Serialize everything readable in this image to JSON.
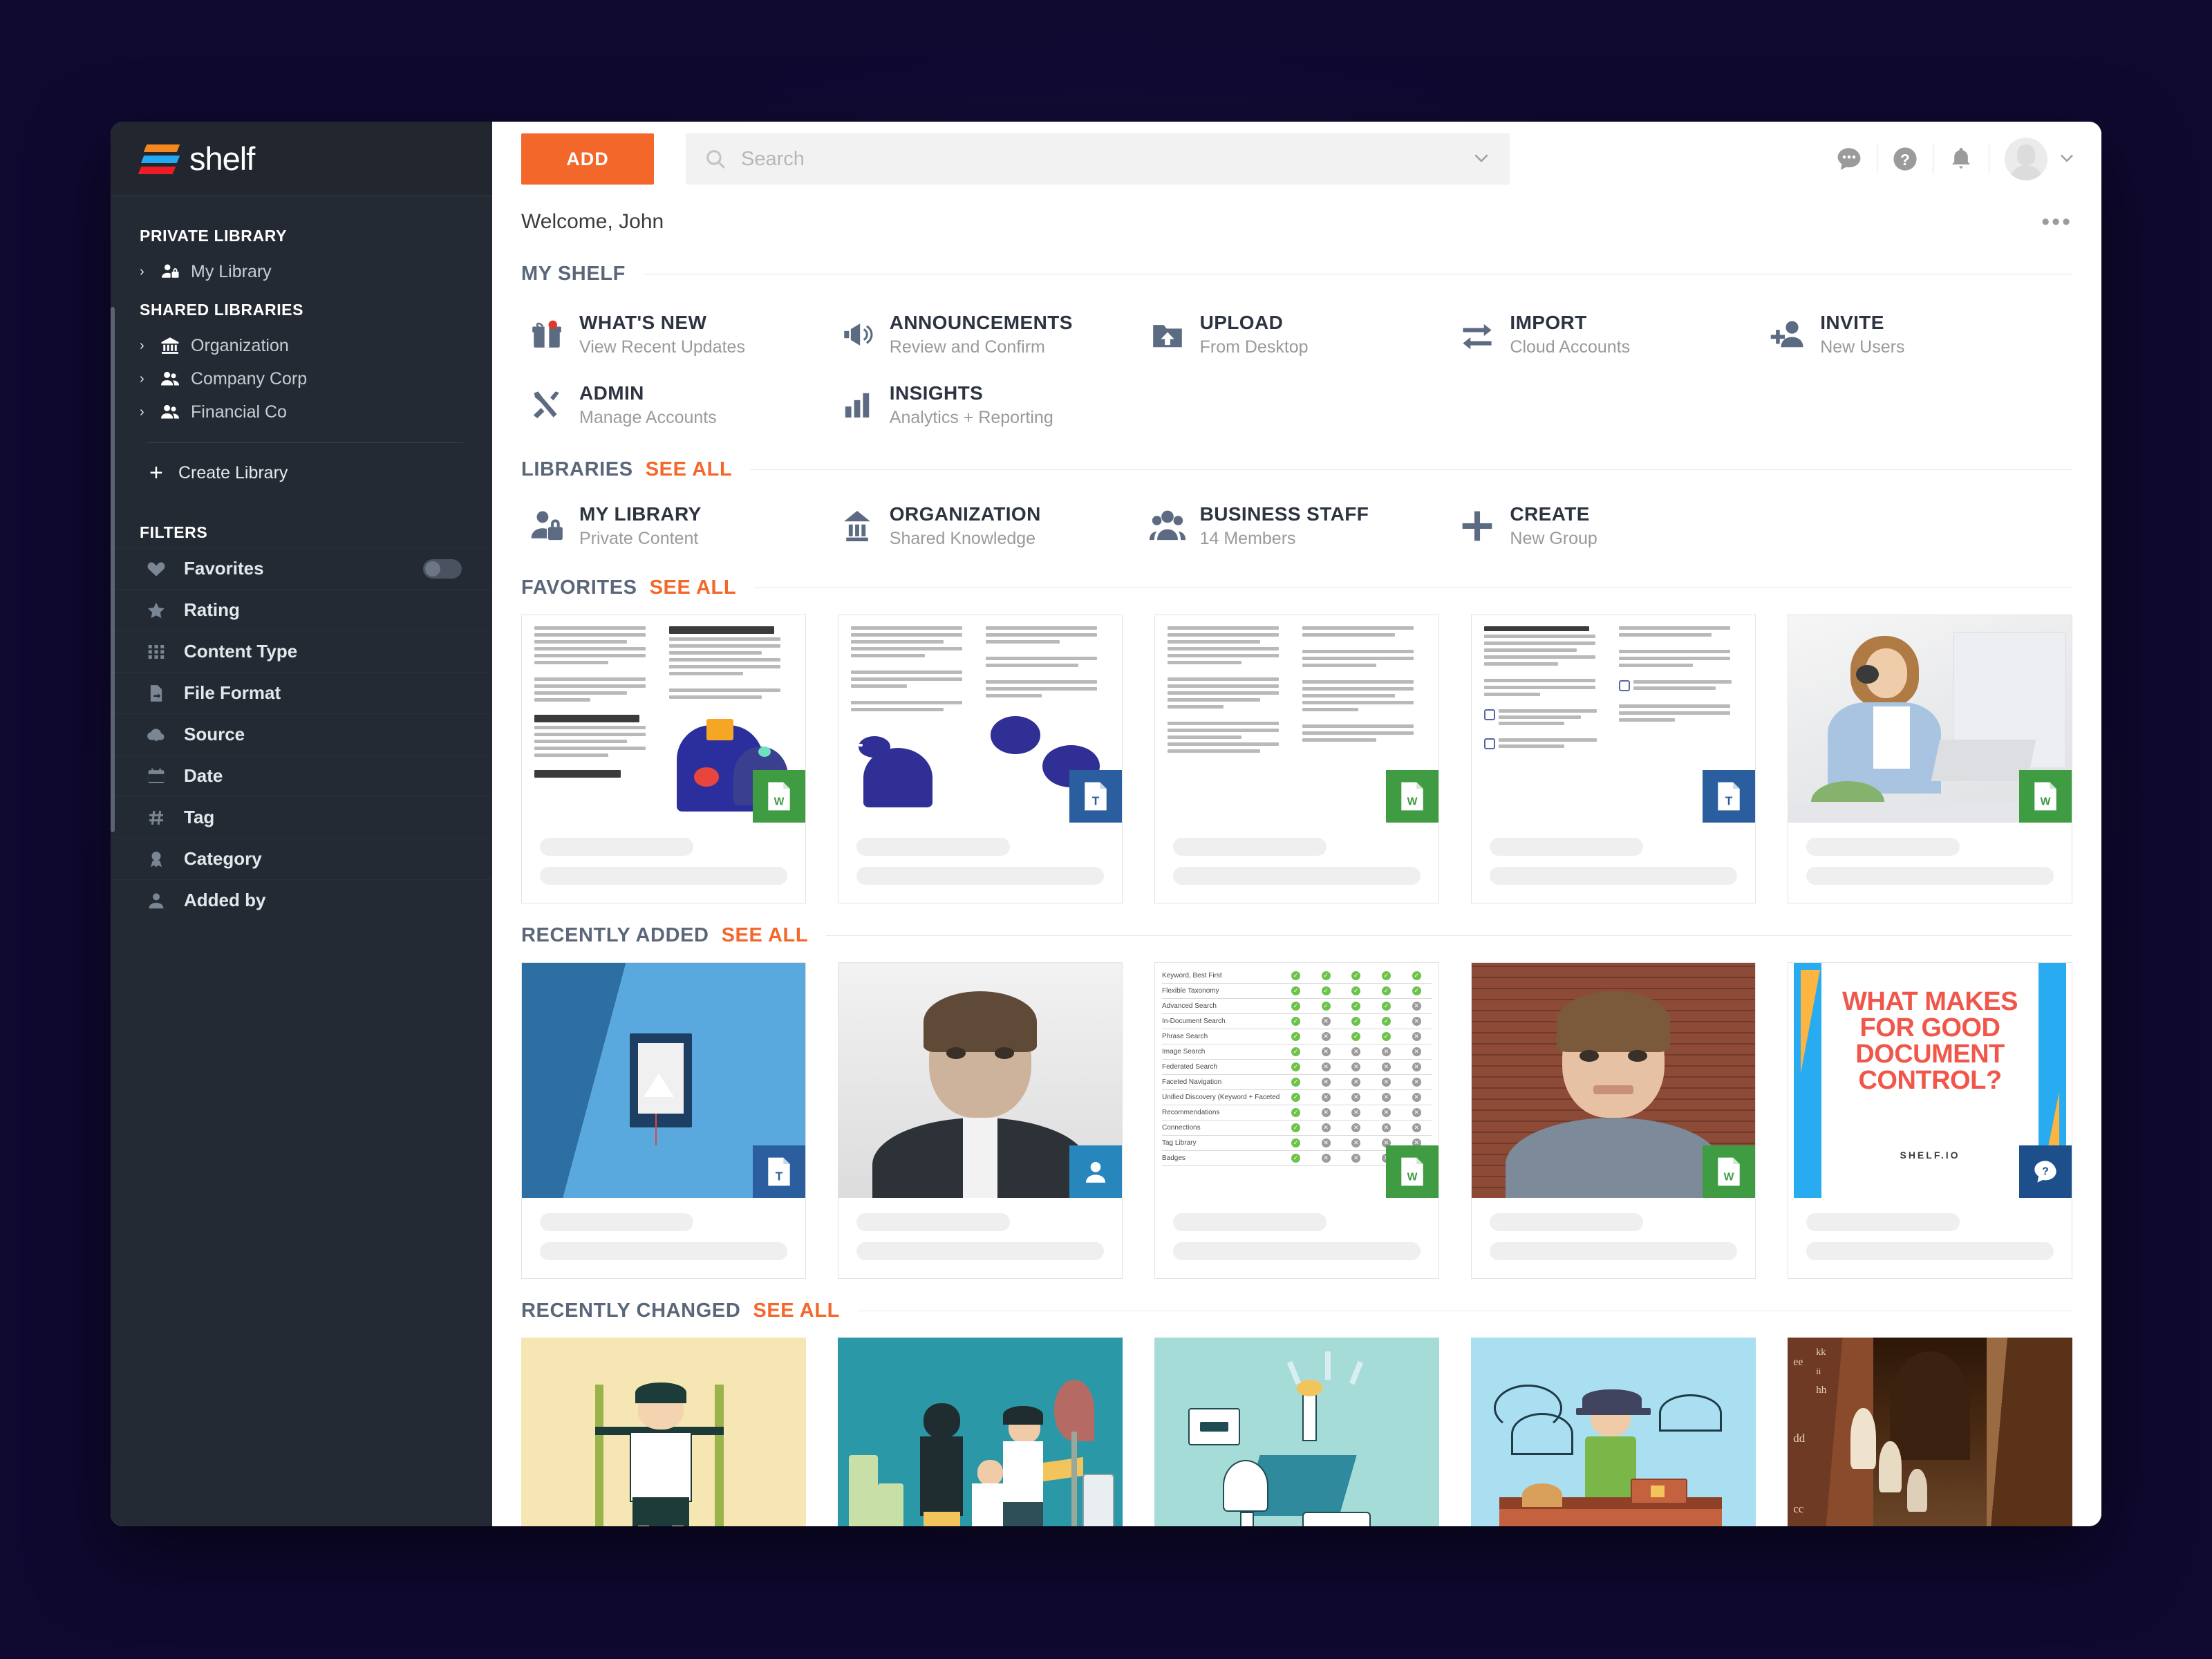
{
  "app": {
    "logo_text": "shelf",
    "logo_colors": [
      "#f5871f",
      "#23a8f2",
      "#ee1c25"
    ],
    "accent": "#f4672b",
    "sidebar_bg": "#242a33"
  },
  "sidebar": {
    "private_header": "PRIVATE LIBRARY",
    "private_items": [
      {
        "label": "My Library",
        "icon": "user-lock-icon",
        "caret": "›"
      }
    ],
    "shared_header": "SHARED LIBRARIES",
    "shared_items": [
      {
        "label": "Organization",
        "icon": "bank-icon",
        "caret": "›"
      },
      {
        "label": "Company Corp",
        "icon": "users-icon",
        "caret": "›"
      },
      {
        "label": "Financial Co",
        "icon": "users-icon",
        "caret": "›"
      }
    ],
    "create_library": "Create Library",
    "create_icon": "plus-icon",
    "filters_header": "FILTERS",
    "filters": [
      {
        "label": "Favorites",
        "icon": "heart-icon",
        "toggle": true,
        "toggle_on": false
      },
      {
        "label": "Rating",
        "icon": "star-icon",
        "toggle": false
      },
      {
        "label": "Content Type",
        "icon": "grid-dots-icon",
        "toggle": false
      },
      {
        "label": "File Format",
        "icon": "file-icon",
        "toggle": false
      },
      {
        "label": "Source",
        "icon": "cloud-download-icon",
        "toggle": false
      },
      {
        "label": "Date",
        "icon": "calendar-icon",
        "toggle": false
      },
      {
        "label": "Tag",
        "icon": "hash-icon",
        "toggle": false
      },
      {
        "label": "Category",
        "icon": "ribbon-icon",
        "toggle": false
      },
      {
        "label": "Added by",
        "icon": "person-icon",
        "toggle": false
      }
    ]
  },
  "topbar": {
    "add_label": "ADD",
    "search_placeholder": "Search",
    "search_value": "",
    "search_icon": "search-icon",
    "dropdown_icon": "chevron-down-icon",
    "icons": [
      {
        "name": "chat-icon"
      },
      {
        "name": "help-icon"
      },
      {
        "name": "bell-icon"
      }
    ],
    "avatar_icon": "avatar",
    "avatar_caret": "chevron-down-icon"
  },
  "welcome": {
    "text": "Welcome, John",
    "overflow_icon": "•••"
  },
  "my_shelf": {
    "title": "MY SHELF",
    "items": [
      {
        "title": "WHAT'S NEW",
        "sub": "View Recent Updates",
        "icon": "gift-icon"
      },
      {
        "title": "ANNOUNCEMENTS",
        "sub": "Review and Confirm",
        "icon": "megaphone-icon"
      },
      {
        "title": "UPLOAD",
        "sub": "From Desktop",
        "icon": "folder-upload-icon"
      },
      {
        "title": "IMPORT",
        "sub": "Cloud Accounts",
        "icon": "transfer-arrows-icon"
      },
      {
        "title": "INVITE",
        "sub": "New Users",
        "icon": "user-plus-icon"
      },
      {
        "title": "ADMIN",
        "sub": "Manage Accounts",
        "icon": "tools-icon"
      },
      {
        "title": "INSIGHTS",
        "sub": "Analytics + Reporting",
        "icon": "bar-chart-icon"
      }
    ]
  },
  "libraries": {
    "title": "LIBRARIES",
    "see_all": "SEE ALL",
    "items": [
      {
        "title": "MY LIBRARY",
        "sub": "Private Content",
        "icon": "user-lock-icon"
      },
      {
        "title": "ORGANIZATION",
        "sub": "Shared Knowledge",
        "icon": "bank-icon"
      },
      {
        "title": "BUSINESS STAFF",
        "sub": "14 Members",
        "icon": "users-icon"
      },
      {
        "title": "CREATE",
        "sub": "New Group",
        "icon": "plus-icon"
      }
    ]
  },
  "favorites": {
    "title": "FAVORITES",
    "see_all": "SEE ALL",
    "cards": [
      {
        "thumb": "document-banking-strategy",
        "badge": "word",
        "badge_label": "W"
      },
      {
        "thumb": "document-chat-bubbles",
        "badge": "text",
        "badge_label": "T"
      },
      {
        "thumb": "document-messaging",
        "badge": "word",
        "badge_label": "W"
      },
      {
        "thumb": "document-banking-chatbot",
        "badge": "text",
        "badge_label": "T"
      },
      {
        "thumb": "photo-headset-agent",
        "badge": "word",
        "badge_label": "W"
      }
    ]
  },
  "recently_added": {
    "title": "RECENTLY ADDED",
    "see_all": "SEE ALL",
    "cards": [
      {
        "thumb": "book-on-blue",
        "badge": "text",
        "badge_label": "T"
      },
      {
        "thumb": "portrait-man-suit",
        "badge": "person",
        "badge_label": ""
      },
      {
        "thumb": "feature-table",
        "badge": "word",
        "badge_label": "W"
      },
      {
        "thumb": "portrait-man-brick",
        "badge": "word",
        "badge_label": "W"
      },
      {
        "thumb": "document-control-poster",
        "badge": "question",
        "badge_label": "?"
      }
    ]
  },
  "recently_changed": {
    "title": "RECENTLY CHANGED",
    "see_all": "SEE ALL",
    "cards": [
      {
        "thumb": "illustration-pullup-cream"
      },
      {
        "thumb": "illustration-family-teal"
      },
      {
        "thumb": "illustration-idea-mint"
      },
      {
        "thumb": "illustration-boat-sky"
      },
      {
        "thumb": "photo-library-hall"
      }
    ]
  },
  "feature_table": {
    "rows": [
      {
        "name": "Keyword, Best First",
        "cells": [
          true,
          true,
          true,
          true,
          true
        ]
      },
      {
        "name": "Flexible Taxonomy",
        "cells": [
          true,
          true,
          true,
          true,
          true
        ]
      },
      {
        "name": "Advanced Search",
        "cells": [
          true,
          true,
          true,
          true,
          false
        ]
      },
      {
        "name": "In-Document Search",
        "cells": [
          true,
          false,
          true,
          true,
          false
        ]
      },
      {
        "name": "Phrase Search",
        "cells": [
          true,
          false,
          true,
          true,
          false
        ]
      },
      {
        "name": "Image Search",
        "cells": [
          true,
          false,
          false,
          false,
          false
        ]
      },
      {
        "name": "Federated Search",
        "cells": [
          true,
          false,
          false,
          false,
          false
        ]
      },
      {
        "name": "Faceted Navigation",
        "cells": [
          true,
          false,
          false,
          false,
          false
        ]
      },
      {
        "name": "Unified Discovery (Keyword + Faceted Search)",
        "cells": [
          true,
          false,
          false,
          false,
          false
        ]
      },
      {
        "name": "Recommendations",
        "cells": [
          true,
          false,
          false,
          false,
          false
        ]
      },
      {
        "name": "Connections",
        "cells": [
          true,
          false,
          false,
          false,
          false
        ]
      },
      {
        "name": "Tag Library",
        "cells": [
          true,
          false,
          false,
          false,
          false
        ]
      },
      {
        "name": "Badges",
        "cells": [
          true,
          false,
          false,
          false,
          false
        ]
      }
    ],
    "yes_glyph": "✓",
    "no_glyph": "✕"
  },
  "document_control_poster": {
    "title": "WHAT MAKES FOR GOOD DOCUMENT CONTROL?",
    "brand": "SHELF.IO"
  }
}
